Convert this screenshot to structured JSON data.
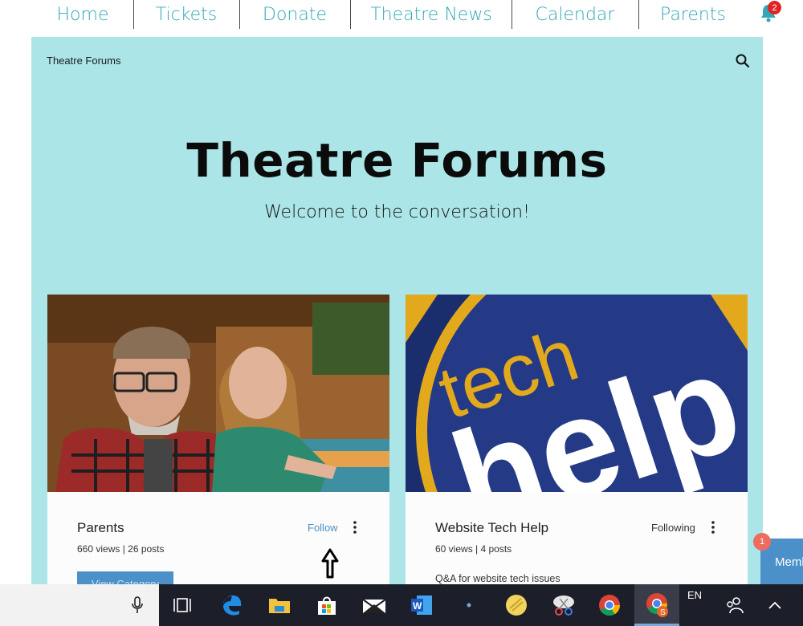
{
  "nav": {
    "items": [
      "Home",
      "Tickets",
      "Donate",
      "Theatre News",
      "Calendar",
      "Parents"
    ],
    "notification_count": "2"
  },
  "forum": {
    "breadcrumb": "Theatre Forums",
    "title": "Theatre Forums",
    "subtitle": "Welcome to the conversation!",
    "categories": [
      {
        "name": "Parents",
        "stats": "660 views | 26 posts",
        "follow_label": "Follow",
        "button_label": "View Category",
        "image": "couple-photo"
      },
      {
        "name": "Website Tech Help",
        "stats": "60 views | 4 posts",
        "follow_label": "Following",
        "description": "Q&A for website tech issues",
        "image": "tech-help-logo"
      }
    ]
  },
  "members_widget": {
    "label": "Members",
    "badge": "1"
  },
  "taskbar": {
    "language": "EN",
    "icons": [
      "microphone-icon",
      "task-view-icon",
      "edge-icon",
      "file-explorer-icon",
      "store-icon",
      "mail-icon",
      "word-icon",
      "dot-icon",
      "sketch-app-icon",
      "snip-icon",
      "chrome-icon",
      "chrome-profile-icon",
      "people-icon",
      "chevron-up-icon"
    ]
  },
  "colors": {
    "accent": "#34a7b5",
    "panel_bg": "#abe5e7",
    "button": "#4b90c8"
  }
}
